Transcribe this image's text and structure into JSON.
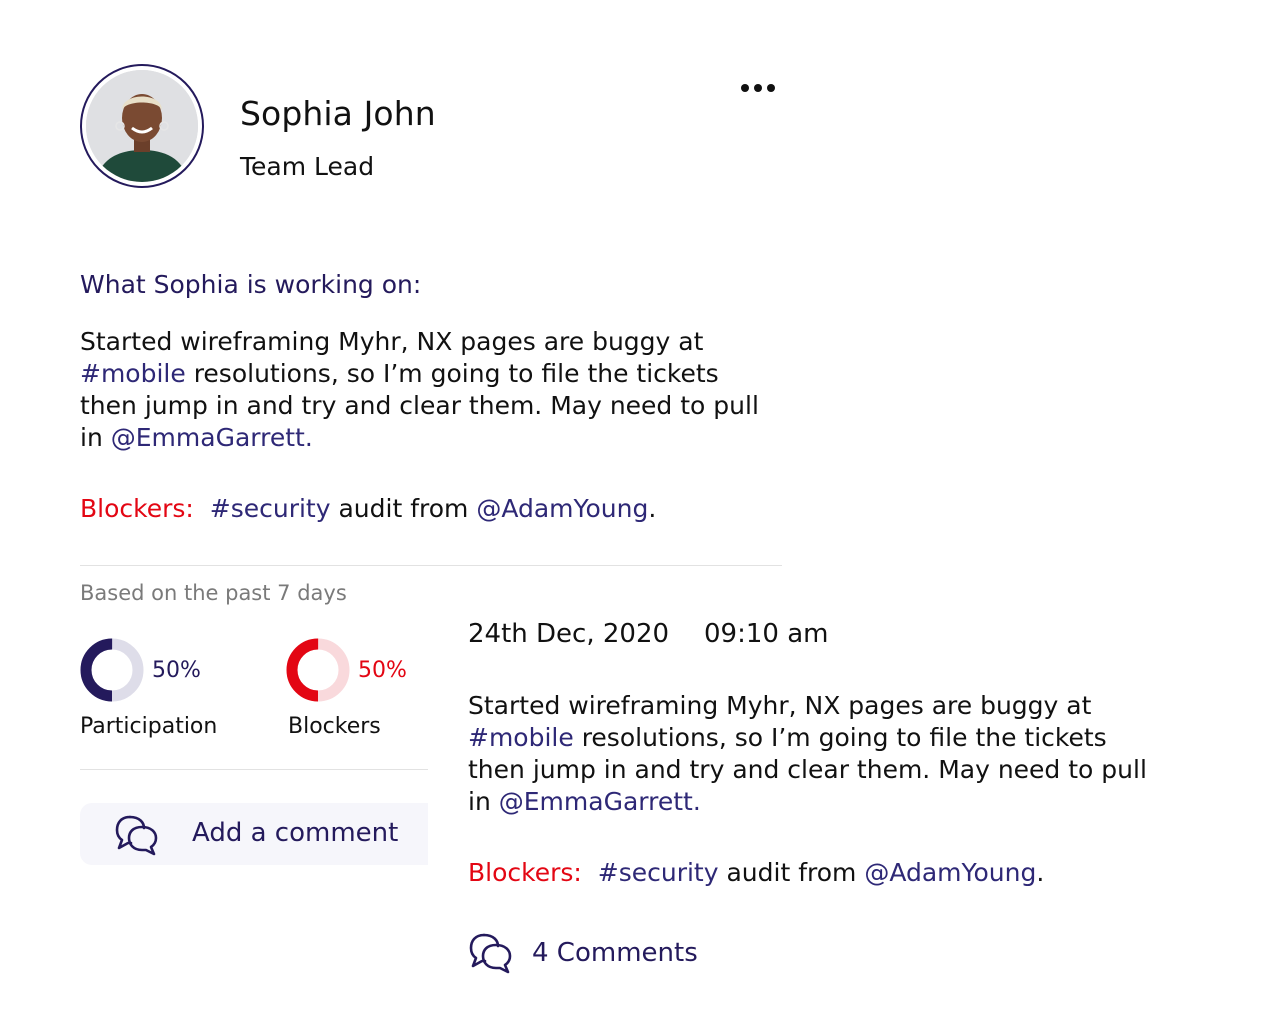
{
  "user": {
    "name": "Sophia John",
    "role": "Team Lead"
  },
  "post": {
    "heading": "What Sophia is working on:",
    "body": {
      "line1": "Started wireframing Myhr, NX pages are buggy at",
      "tag_mobile": "#mobile",
      "line2_rest": " resolutions, so I’m going to file the tickets",
      "line3": "then jump in and try and clear them. May need to pull",
      "line4_prefix": "in ",
      "mention_emma": "@EmmaGarrett."
    },
    "blockers": {
      "label": "Blockers:",
      "tag": "#security",
      "text": " audit from ",
      "mention": "@AdamYoung",
      "end": "."
    }
  },
  "stats": {
    "caption": "Based on the past 7 days",
    "participation": {
      "value": "50%",
      "label": "Participation",
      "fraction": 0.5,
      "color": "#241a5c",
      "track_color": "#dedde9"
    },
    "blockers": {
      "value": "50%",
      "label": "Blockers",
      "fraction": 0.5,
      "color": "#e30613",
      "track_color": "#f9d9dc"
    }
  },
  "add_comment": {
    "label": "Add a comment"
  },
  "entry": {
    "date": "24th Dec, 2020",
    "time": "09:10 am",
    "body": {
      "line1": "Started wireframing Myhr, NX pages are buggy at",
      "tag_mobile": "#mobile",
      "line2_rest": " resolutions, so I’m going to file the tickets",
      "line3": "then jump in and try and clear them. May need to pull",
      "line4_prefix": "in ",
      "mention_emma": "@EmmaGarrett."
    },
    "blockers": {
      "label": "Blockers:",
      "tag": "#security",
      "text": " audit from ",
      "mention": "@AdamYoung",
      "end": "."
    },
    "comments_label": "4 Comments"
  },
  "colors": {
    "brand": "#241a5c",
    "link": "#2e2876",
    "alert": "#e30613"
  },
  "icons": {
    "more": "more-horizontal-icon",
    "comment": "chat-bubbles-icon"
  }
}
